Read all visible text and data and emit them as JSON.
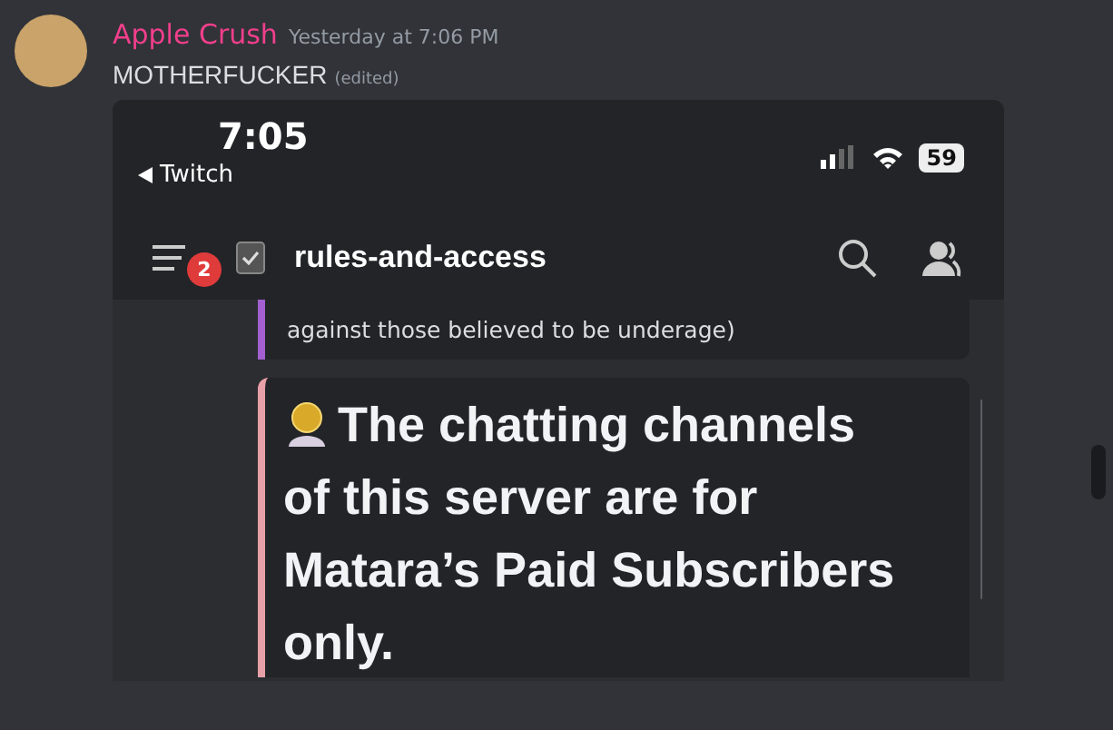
{
  "message": {
    "author": "Apple Crush",
    "timestamp": "Yesterday at 7:06 PM",
    "text": "MOTHERFUCKER",
    "edited_label": "(edited)"
  },
  "attachment": {
    "status_bar": {
      "time": "7:05",
      "back_label": "Twitch",
      "battery": "59"
    },
    "header": {
      "badge": "2",
      "channel": "rules-and-access"
    },
    "cards": [
      {
        "kind": "note",
        "text": "against those believed to be underage)",
        "color": "#a35fd0"
      },
      {
        "kind": "heading",
        "text": "The chatting channels of this server are for Matara’s Paid Subscribers only.",
        "color": "#e8a0a8"
      }
    ]
  }
}
